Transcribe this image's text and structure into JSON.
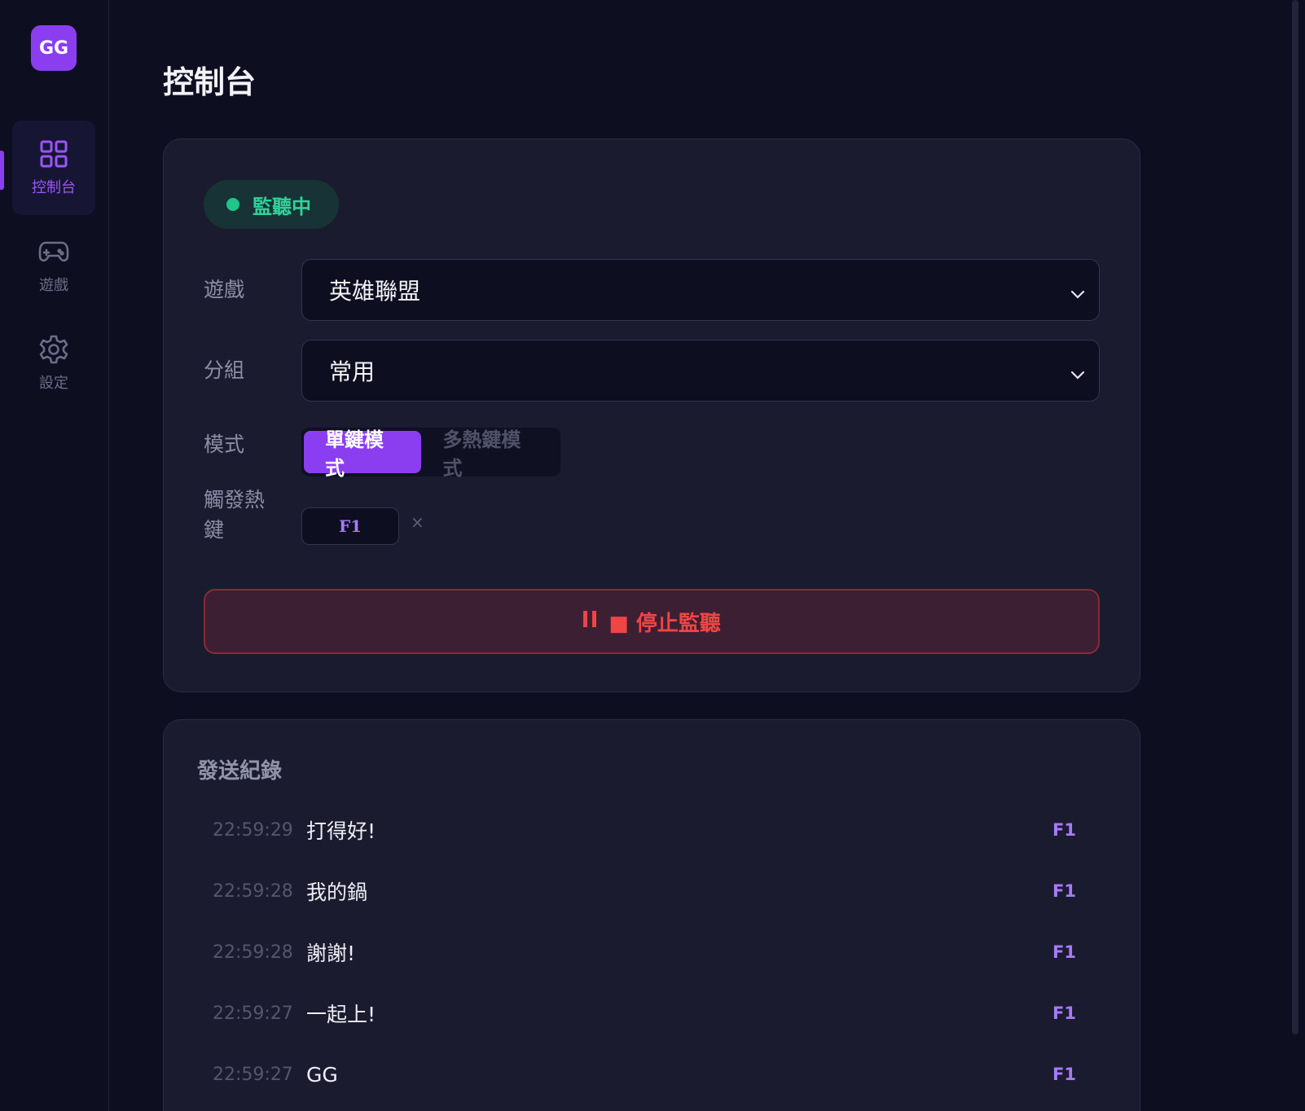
{
  "app": {
    "logo_text": "GG"
  },
  "sidebar": {
    "items": [
      {
        "label": "控制台",
        "icon": "dashboard-grid-icon",
        "active": true
      },
      {
        "label": "遊戲",
        "icon": "gamepad-icon",
        "active": false
      },
      {
        "label": "設定",
        "icon": "gear-icon",
        "active": false
      }
    ]
  },
  "page": {
    "title": "控制台"
  },
  "control": {
    "status": "監聽中",
    "game_label": "遊戲",
    "game_value": "英雄聯盟",
    "group_label": "分組",
    "group_value": "常用",
    "mode_label": "模式",
    "modes": [
      "單鍵模式",
      "多熱鍵模式"
    ],
    "active_mode": "單鍵模式",
    "hotkey_label": "觸發熱鍵",
    "hotkey_value": "F1",
    "hotkey_remove": "×",
    "stop_button": "■ 停止監聽"
  },
  "log": {
    "title": "發送紀錄",
    "entries": [
      {
        "time": "22:59:29",
        "message": "打得好!",
        "key": "F1"
      },
      {
        "time": "22:59:28",
        "message": "我的鍋",
        "key": "F1"
      },
      {
        "time": "22:59:28",
        "message": "謝謝!",
        "key": "F1"
      },
      {
        "time": "22:59:27",
        "message": "一起上!",
        "key": "F1"
      },
      {
        "time": "22:59:27",
        "message": "GG",
        "key": "F1"
      }
    ]
  },
  "colors": {
    "accent": "#8b3ef0",
    "status_green": "#2fd39a",
    "danger_red": "#ee4545",
    "background": "#0d0e20",
    "card": "#1a1b2f"
  }
}
